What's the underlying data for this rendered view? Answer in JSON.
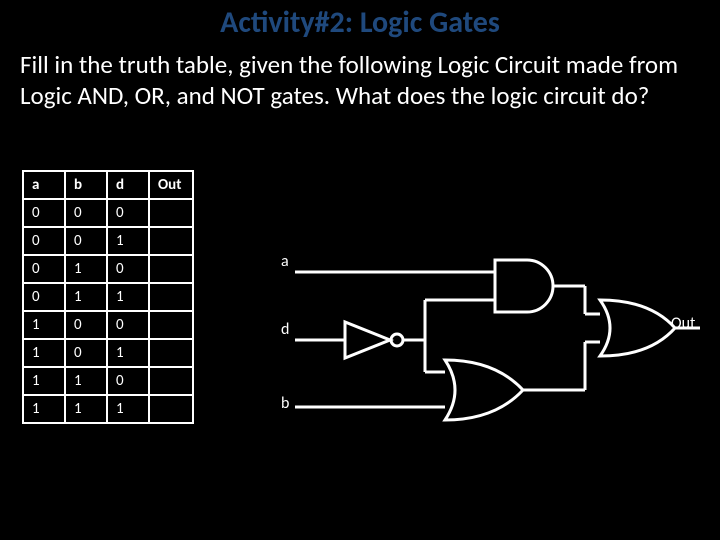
{
  "title": "Activity#2: Logic Gates",
  "body": "Fill in the truth table, given the following Logic Circuit made from Logic AND, OR, and NOT gates. What does the logic circuit do?",
  "truth_table": {
    "headers": [
      "a",
      "b",
      "d",
      "Out"
    ],
    "rows": [
      [
        "0",
        "0",
        "0",
        ""
      ],
      [
        "0",
        "0",
        "1",
        ""
      ],
      [
        "0",
        "1",
        "0",
        ""
      ],
      [
        "0",
        "1",
        "1",
        ""
      ],
      [
        "1",
        "0",
        "0",
        ""
      ],
      [
        "1",
        "0",
        "1",
        ""
      ],
      [
        "1",
        "1",
        "0",
        ""
      ],
      [
        "1",
        "1",
        "1",
        ""
      ]
    ]
  },
  "circuit": {
    "inputs": {
      "a": "a",
      "d": "d",
      "b": "b"
    },
    "output": "Out"
  }
}
